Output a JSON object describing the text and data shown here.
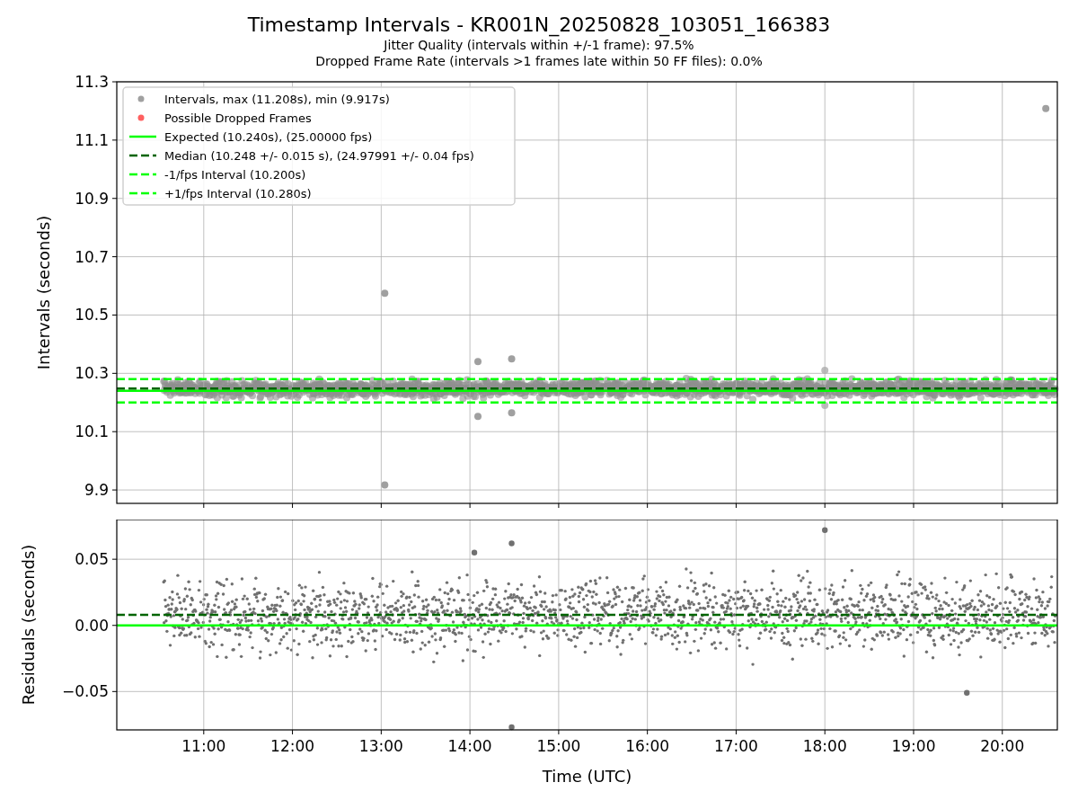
{
  "figure": {
    "title": "Timestamp Intervals - KR001N_20250828_103051_166383",
    "subtitles": [
      "Jitter Quality (intervals within +/-1 frame): 97.5%",
      "Dropped Frame Rate (intervals >1 frames late within 50 FF files): 0.0%"
    ]
  },
  "intervals_chart": {
    "chart_data": {
      "type": "scatter",
      "ylabel": "Intervals (seconds)",
      "grid": true,
      "legend": "upper left",
      "xlim": [
        10.02,
        20.62
      ],
      "ylim": [
        9.854,
        11.3
      ],
      "yticks": [
        {
          "value": 9.9,
          "label": "9.9"
        },
        {
          "value": 10.1,
          "label": "10.1"
        },
        {
          "value": 10.3,
          "label": "10.3"
        },
        {
          "value": 10.5,
          "label": "10.5"
        },
        {
          "value": 10.7,
          "label": "10.7"
        },
        {
          "value": 10.9,
          "label": "10.9"
        },
        {
          "value": 11.1,
          "label": "11.1"
        },
        {
          "value": 11.3,
          "label": "11.3"
        }
      ],
      "series": [
        {
          "name": "Intervals, max (11.208s), min (9.917s)",
          "color": "#a0a0a0",
          "x": [
            20.49,
            13.04,
            13.04,
            14.09,
            14.09,
            14.47,
            14.47
          ],
          "values": [
            11.208,
            10.575,
            9.917,
            10.34,
            10.152,
            10.35,
            10.165
          ]
        },
        {
          "name": "Possible Dropped Frames",
          "color": "#ff6060"
        },
        {
          "name": "Expected (10.240s), (25.00000 fps)",
          "type": "line",
          "line_style": "solid",
          "color": "#00ff00",
          "x": [
            10.02,
            20.62
          ],
          "values": [
            10.24,
            10.24
          ]
        },
        {
          "name": "Median (10.248 +/- 0.015 s), (24.97991 +/- 0.04 fps)",
          "type": "line",
          "line_style": "dashed",
          "color": "#006400",
          "x": [
            10.02,
            20.62
          ],
          "values": [
            10.248,
            10.248
          ]
        },
        {
          "name": "-1/fps Interval (10.200s)",
          "type": "line",
          "line_style": "dashed",
          "color": "#00ff00",
          "x": [
            10.02,
            20.62
          ],
          "values": [
            10.2,
            10.2
          ]
        },
        {
          "name": "+1/fps Interval (10.280s)",
          "type": "line",
          "line_style": "dashed",
          "color": "#00ff00",
          "x": [
            10.02,
            20.62
          ],
          "values": [
            10.28,
            10.28
          ]
        }
      ]
    }
  },
  "residuals_chart": {
    "chart_data": {
      "type": "scatter",
      "xlabel": "Time (UTC)",
      "ylabel": "Residuals (seconds)",
      "grid": true,
      "xlim": [
        10.02,
        20.62
      ],
      "ylim": [
        -0.079,
        0.08
      ],
      "xticks": [
        {
          "value": 11,
          "label": "11:00"
        },
        {
          "value": 12,
          "label": "12:00"
        },
        {
          "value": 13,
          "label": "13:00"
        },
        {
          "value": 14,
          "label": "14:00"
        },
        {
          "value": 15,
          "label": "15:00"
        },
        {
          "value": 16,
          "label": "16:00"
        },
        {
          "value": 17,
          "label": "17:00"
        },
        {
          "value": 18,
          "label": "18:00"
        },
        {
          "value": 19,
          "label": "19:00"
        },
        {
          "value": 20,
          "label": "20:00"
        }
      ],
      "yticks": [
        {
          "value": -0.05,
          "label": "−0.05"
        },
        {
          "value": 0,
          "label": "0.00"
        },
        {
          "value": 0.05,
          "label": "0.05"
        }
      ],
      "series": [
        {
          "color": "#707070",
          "x": [
            18.0,
            14.47,
            19.6,
            14.47,
            14.05
          ],
          "values": [
            0.072,
            -0.077,
            -0.051,
            0.062,
            0.055
          ]
        },
        {
          "type": "line",
          "line_style": "solid",
          "color": "#00ff00",
          "x": [
            10.02,
            20.62
          ],
          "values": [
            0,
            0
          ]
        },
        {
          "type": "line",
          "line_style": "dashed",
          "color": "#006400",
          "x": [
            10.02,
            20.62
          ],
          "values": [
            0.008,
            0.008
          ]
        }
      ]
    }
  }
}
